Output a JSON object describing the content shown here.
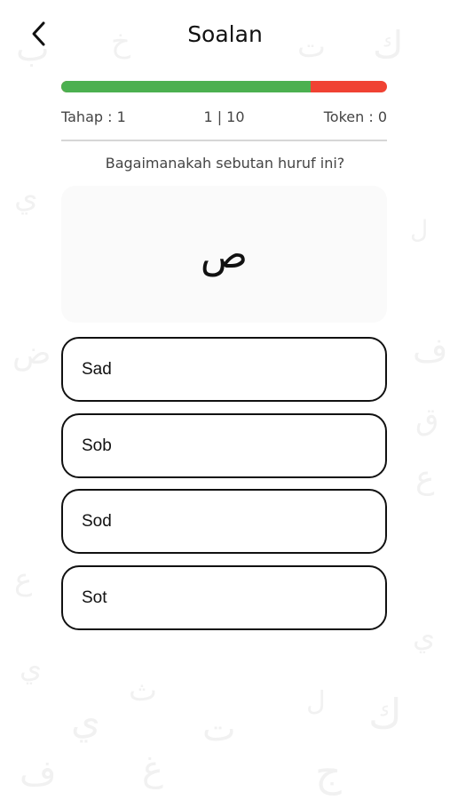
{
  "header": {
    "title": "Soalan",
    "back_icon": "chevron-left-icon"
  },
  "progress": {
    "fraction_complete": 0.766,
    "fill_color": "#4cb050",
    "remaining_color": "#f04233"
  },
  "stats": {
    "level": "Tahap : 1",
    "question_count": "1 | 10",
    "token": "Token : 0"
  },
  "question": {
    "prompt": "Bagaimanakah sebutan huruf ini?",
    "letter": "ص"
  },
  "answers": [
    {
      "label": "Sad"
    },
    {
      "label": "Sob"
    },
    {
      "label": "Sod"
    },
    {
      "label": "Sot"
    }
  ],
  "background_glyphs": [
    "ب",
    "ت",
    "خ",
    "ك",
    "ع",
    "ث",
    "ي",
    "ف",
    "ض",
    "ج",
    "ق",
    "غ",
    "ل"
  ]
}
